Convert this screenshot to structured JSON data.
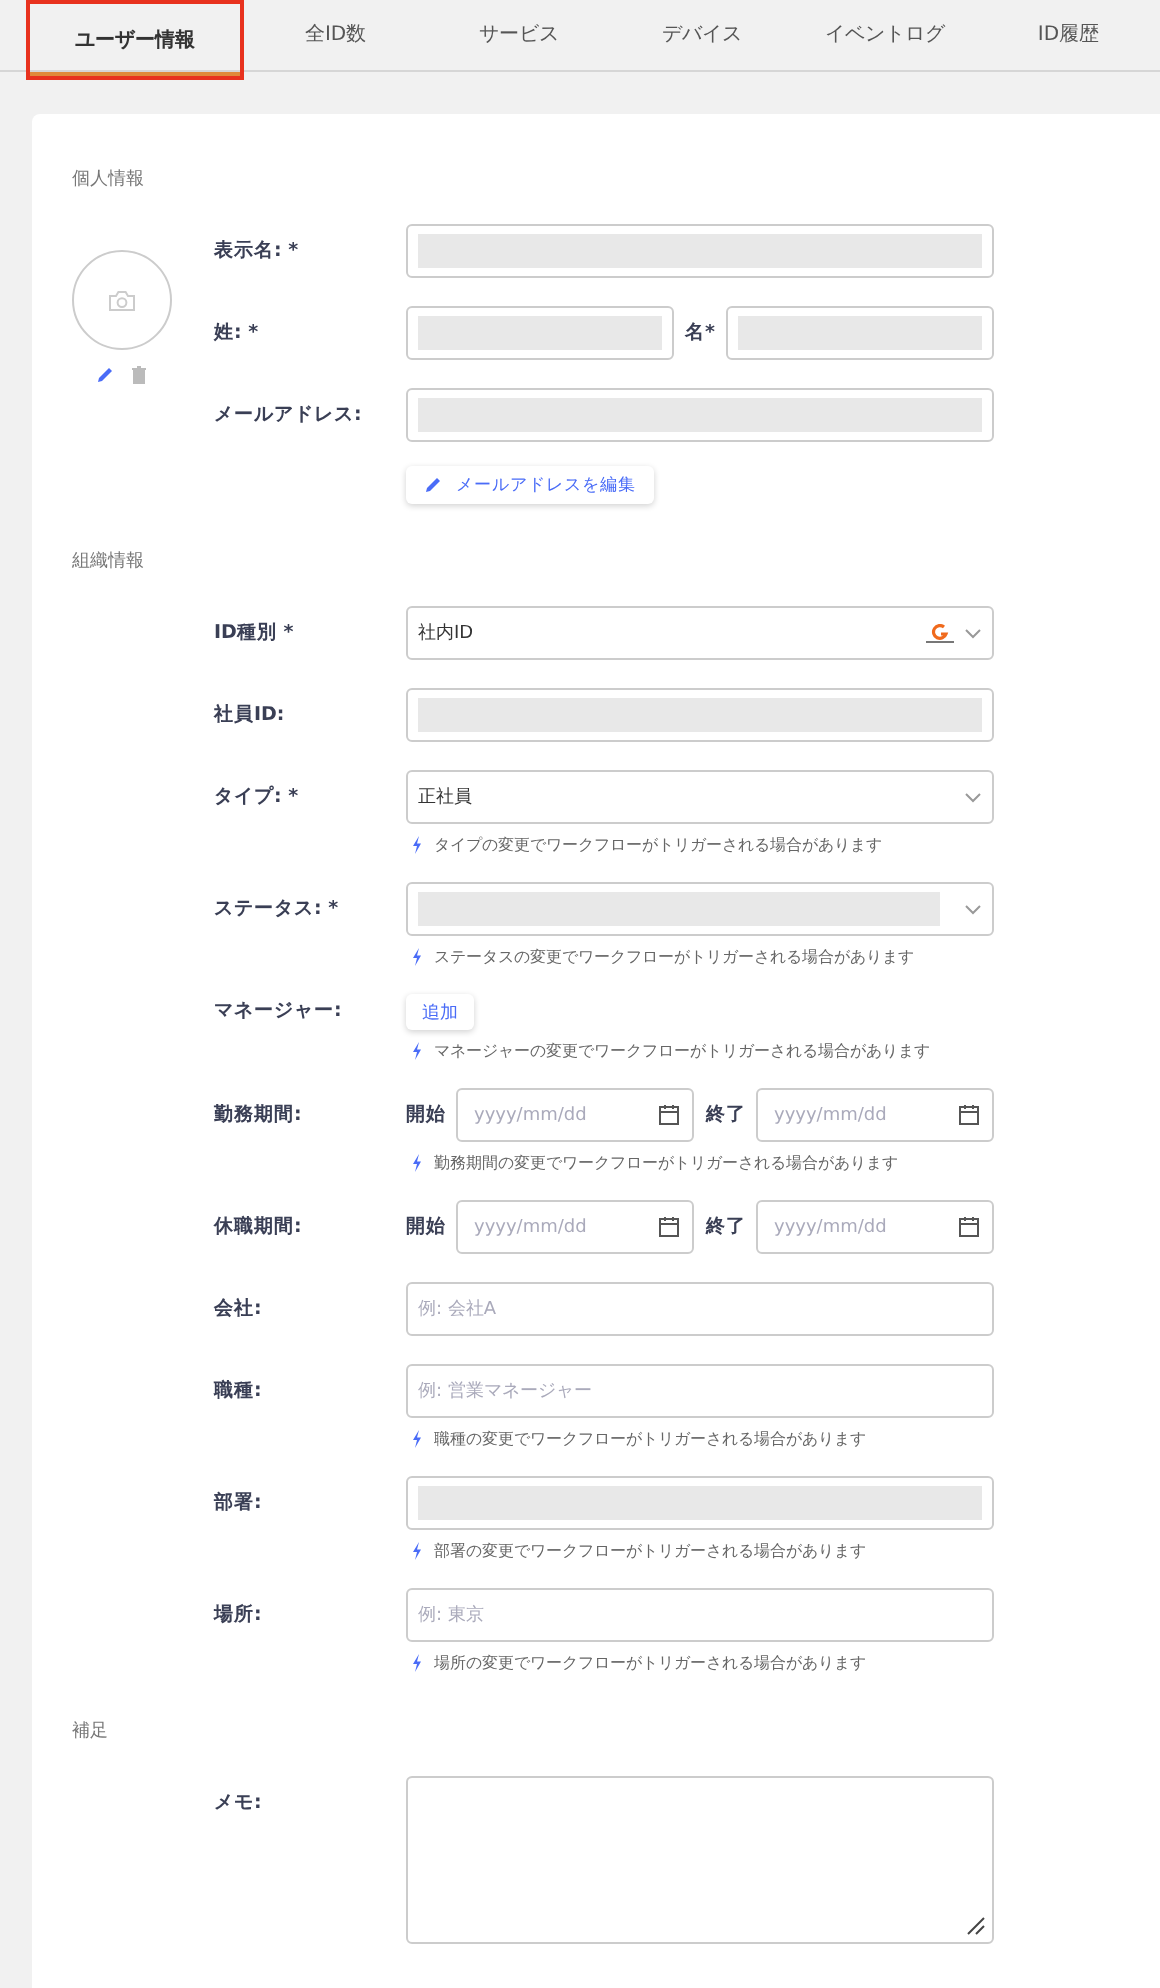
{
  "tabs": [
    {
      "label": "ユーザー情報",
      "selected": true
    },
    {
      "label": "全ID数",
      "selected": false
    },
    {
      "label": "サービス",
      "selected": false
    },
    {
      "label": "デバイス",
      "selected": false
    },
    {
      "label": "イベントログ",
      "selected": false
    },
    {
      "label": "ID履歴",
      "selected": false
    }
  ],
  "sections": [
    {
      "title": "個人情報",
      "avatar": true,
      "fields": [
        {
          "kind": "text",
          "label": "表示名: *",
          "redacted": true
        },
        {
          "kind": "name_pair",
          "label": "姓: *",
          "second_label": "名*",
          "redacted": true
        },
        {
          "kind": "text",
          "label": "メールアドレス:",
          "redacted": true,
          "action": "メールアドレスを編集"
        }
      ]
    },
    {
      "title": "組織情報",
      "fields": [
        {
          "kind": "select",
          "label": "ID種別 *",
          "value": "社内ID",
          "logo": true
        },
        {
          "kind": "text",
          "label": "社員ID:",
          "redacted": true
        },
        {
          "kind": "select",
          "label": "タイプ: *",
          "value": "正社員",
          "hint": "タイプの変更でワークフローがトリガーされる場合があります"
        },
        {
          "kind": "select",
          "label": "ステータス: *",
          "redacted": true,
          "hint": "ステータスの変更でワークフローがトリガーされる場合があります"
        },
        {
          "kind": "button",
          "label": "マネージャー:",
          "button": "追加",
          "hint": "マネージャーの変更でワークフローがトリガーされる場合があります"
        },
        {
          "kind": "date_range",
          "label": "勤務期間:",
          "start_label": "開始",
          "start_placeholder": "yyyy/mm/dd",
          "end_label": "終了",
          "end_placeholder": "yyyy/mm/dd",
          "hint": "勤務期間の変更でワークフローがトリガーされる場合があります"
        },
        {
          "kind": "date_range",
          "label": "休職期間:",
          "start_label": "開始",
          "start_placeholder": "yyyy/mm/dd",
          "end_label": "終了",
          "end_placeholder": "yyyy/mm/dd"
        },
        {
          "kind": "text",
          "label": "会社:",
          "placeholder": "例: 会社A"
        },
        {
          "kind": "text",
          "label": "職種:",
          "placeholder": "例: 営業マネージャー",
          "hint": "職種の変更でワークフローがトリガーされる場合があります"
        },
        {
          "kind": "text",
          "label": "部署:",
          "redacted": true,
          "hint": "部署の変更でワークフローがトリガーされる場合があります"
        },
        {
          "kind": "text",
          "label": "場所:",
          "placeholder": "例: 東京",
          "hint": "場所の変更でワークフローがトリガーされる場合があります"
        }
      ]
    },
    {
      "title": "補足",
      "fields": [
        {
          "kind": "textarea",
          "label": "メモ:"
        }
      ]
    }
  ]
}
